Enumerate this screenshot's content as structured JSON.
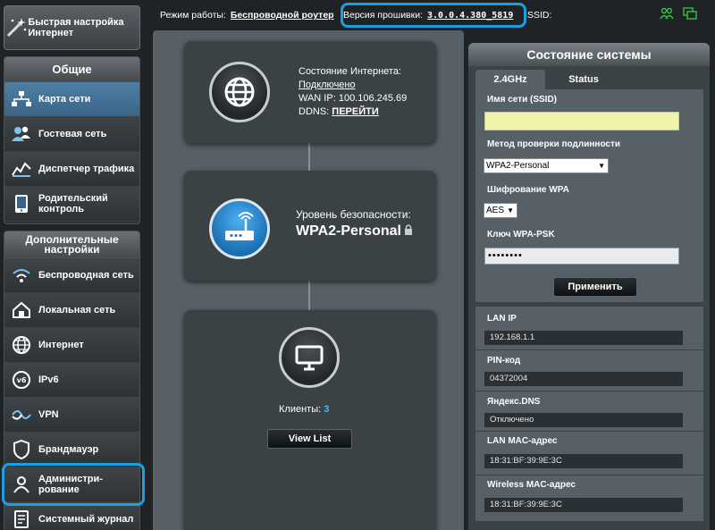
{
  "topbar": {
    "mode_label": "Режим работы:",
    "mode_value": "Беспроводной роутер",
    "firmware_label": "Версия прошивки:",
    "firmware_value": "3.0.0.4.380_5819",
    "ssid_label": "SSID:"
  },
  "sidebar": {
    "quick_setup": "Быстрая настройка Интернет",
    "general_title": "Общие",
    "general_items": [
      {
        "label": "Карта сети",
        "icon": "network-map-icon"
      },
      {
        "label": "Гостевая сеть",
        "icon": "guest-network-icon"
      },
      {
        "label": "Диспетчер трафика",
        "icon": "traffic-manager-icon"
      },
      {
        "label": "Родительский контроль",
        "icon": "parental-control-icon"
      }
    ],
    "advanced_title": "Дополнительные настройки",
    "advanced_items": [
      {
        "label": "Беспроводная сеть",
        "icon": "wireless-icon"
      },
      {
        "label": "Локальная сеть",
        "icon": "lan-icon"
      },
      {
        "label": "Интернет",
        "icon": "internet-icon"
      },
      {
        "label": "IPv6",
        "icon": "ipv6-icon"
      },
      {
        "label": "VPN",
        "icon": "vpn-icon"
      },
      {
        "label": "Брандмауэр",
        "icon": "firewall-icon"
      },
      {
        "label": "Администри- рование",
        "icon": "administration-icon"
      },
      {
        "label": "Системный журнал",
        "icon": "system-log-icon"
      }
    ]
  },
  "map": {
    "internet_status_label": "Состояние Интернета:",
    "internet_status_value": "Подключено",
    "wan_ip_label": "WAN IP:",
    "wan_ip_value": "100.106.245.69",
    "ddns_label": "DDNS:",
    "ddns_value": "ПЕРЕЙТИ",
    "security_label": "Уровень безопасности:",
    "security_value": "WPA2-Personal",
    "clients_label": "Клиенты:",
    "clients_count": "3",
    "view_list_label": "View List"
  },
  "status": {
    "title": "Состояние системы",
    "tabs": [
      "2.4GHz",
      "Status"
    ],
    "ssid_label": "Имя сети (SSID)",
    "ssid_value": "",
    "auth_label": "Метод проверки подлинности",
    "auth_value": "WPA2-Personal",
    "wpa_enc_label": "Шифрование WPA",
    "wpa_enc_value": "AES",
    "psk_label": "Ключ WPA-PSK",
    "psk_value": "••••••••",
    "apply_label": "Применить",
    "lan_ip_label": "LAN IP",
    "lan_ip_value": "192.168.1.1",
    "pin_label": "PIN-код",
    "pin_value": "04372004",
    "dns_label": "Яндекс.DNS",
    "dns_value": "Отключено",
    "lan_mac_label": "LAN MAC-адрес",
    "lan_mac_value": "18:31:BF:39:9E:3C",
    "wl_mac_label": "Wireless MAC-адрес",
    "wl_mac_value": "18:31:BF:39:9E:3C"
  },
  "colors": {
    "accent_highlight": "#1aa0e0",
    "active_nav": "#3a6487",
    "ssid_field": "#f1f3a8",
    "clients_count": "#52b5f3"
  }
}
